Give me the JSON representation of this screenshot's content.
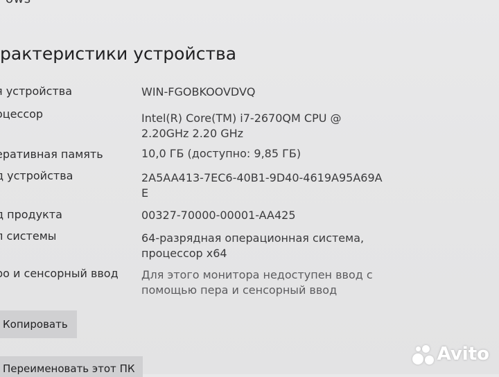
{
  "header": {
    "top_word": "ows",
    "title": "рактеристики устройства"
  },
  "rows": [
    {
      "label": "я устройства",
      "value_lines": [
        "WIN-FGOBKOOVDVQ"
      ]
    },
    {
      "label": "оцессор",
      "value_lines": [
        "Intel(R) Core(TM) i7-2670QM CPU @",
        "2.20GHz   2.20 GHz"
      ]
    },
    {
      "label": "еративная память",
      "value_lines": [
        "10,0 ГБ (доступно: 9,85 ГБ)"
      ]
    },
    {
      "label": "д устройства",
      "value_lines": [
        "2A5AA413-7EC6-40B1-9D40-4619A95A69A",
        "E"
      ]
    },
    {
      "label": "д продукта",
      "value_lines": [
        "00327-70000-00001-AA425"
      ]
    },
    {
      "label": "п системы",
      "value_lines": [
        "64-разрядная операционная система,",
        "процессор x64"
      ]
    },
    {
      "label": "ро и сенсорный ввод",
      "value_lines": [
        "Для этого монитора недоступен ввод с",
        "помощью пера и сенсорный ввод"
      ]
    }
  ],
  "buttons": {
    "copy": "Копировать",
    "rename": "Переименовать этот ПК"
  },
  "watermark": {
    "brand": "Avito"
  }
}
